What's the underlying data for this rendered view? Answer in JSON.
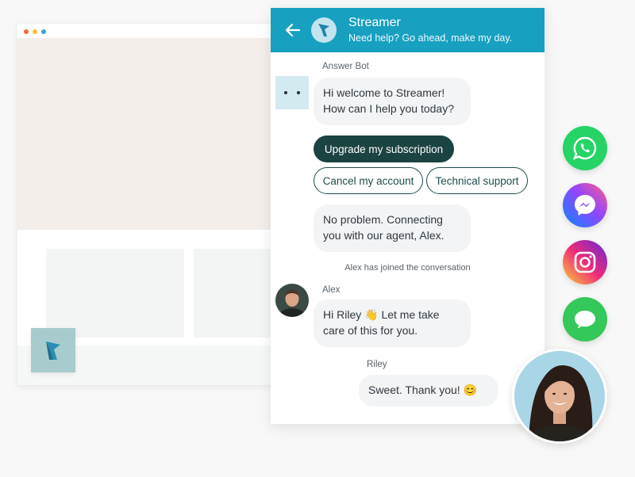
{
  "colors": {
    "header_bg": "#17a0c0",
    "selected_reply_bg": "#1b4341",
    "reply_border": "#1e4d4c",
    "bubble_bg": "#f3f4f5",
    "whatsapp": "#25d366",
    "messages": "#34c759"
  },
  "header": {
    "title": "Streamer",
    "subtitle": "Need help? Go ahead, make my day."
  },
  "conversation": {
    "bot_label": "Answer Bot",
    "bot_greeting_line1": "Hi welcome to Streamer!",
    "bot_greeting_line2": "How can I help you today?",
    "quick_replies": [
      {
        "label": "Upgrade my subscription",
        "selected": true
      },
      {
        "label": "Cancel my account",
        "selected": false
      },
      {
        "label": "Technical support",
        "selected": false
      }
    ],
    "bot_reply_line1": "No problem. Connecting",
    "bot_reply_line2": "you with our agent, Alex.",
    "system_note": "Alex has joined the conversation",
    "agent_label": "Alex",
    "agent_msg_line1": "Hi Riley 👋 Let me take",
    "agent_msg_line2": "care of this for you.",
    "customer_label": "Riley",
    "customer_msg": "Sweet. Thank you! 😊"
  },
  "channels": [
    {
      "name": "WhatsApp",
      "icon": "whatsapp-icon"
    },
    {
      "name": "Messenger",
      "icon": "messenger-icon"
    },
    {
      "name": "Instagram",
      "icon": "instagram-icon"
    },
    {
      "name": "Messages",
      "icon": "messages-icon"
    }
  ]
}
